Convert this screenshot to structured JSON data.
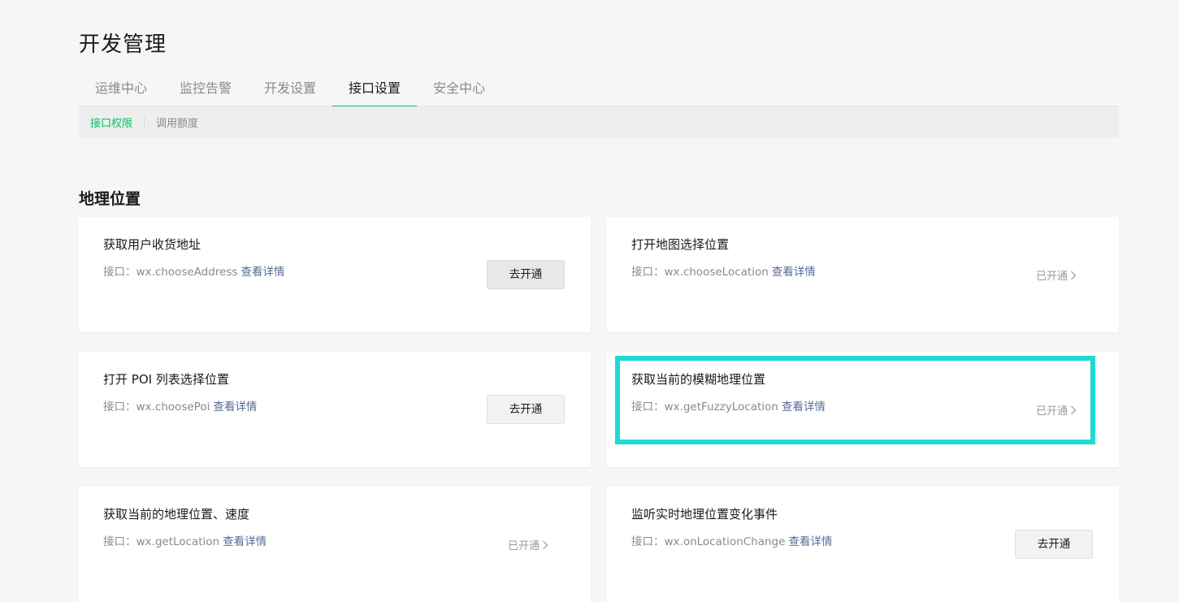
{
  "page": {
    "title": "开发管理"
  },
  "tabs": [
    {
      "label": "运维中心"
    },
    {
      "label": "监控告警"
    },
    {
      "label": "开发设置"
    },
    {
      "label": "接口设置"
    },
    {
      "label": "安全中心"
    }
  ],
  "active_tab_index": 3,
  "subtabs": [
    {
      "label": "接口权限"
    },
    {
      "label": "调用额度"
    }
  ],
  "section": {
    "title": "地理位置"
  },
  "interface_prefix": "接口：",
  "detail_link": "查看详情",
  "cards": [
    {
      "title": "获取用户收货地址",
      "api": "wx.chooseAddress",
      "status": "去开通",
      "opened": false
    },
    {
      "title": "打开地图选择位置",
      "api": "wx.chooseLocation",
      "status": "已开通",
      "opened": true
    },
    {
      "title": "打开 POI 列表选择位置",
      "api": "wx.choosePoi",
      "status": "去开通",
      "opened": false
    },
    {
      "title": "获取当前的模糊地理位置",
      "api": "wx.getFuzzyLocation",
      "status": "已开通",
      "opened": true,
      "highlighted": true
    },
    {
      "title": "获取当前的地理位置、速度",
      "api": "wx.getLocation",
      "status": "已开通",
      "opened": true
    },
    {
      "title": "监听实时地理位置变化事件",
      "api": "wx.onLocationChange",
      "status": "去开通",
      "opened": false
    }
  ],
  "colors": {
    "accent": "#07c160",
    "link": "#576b95",
    "highlight_border": "#1edad3"
  }
}
